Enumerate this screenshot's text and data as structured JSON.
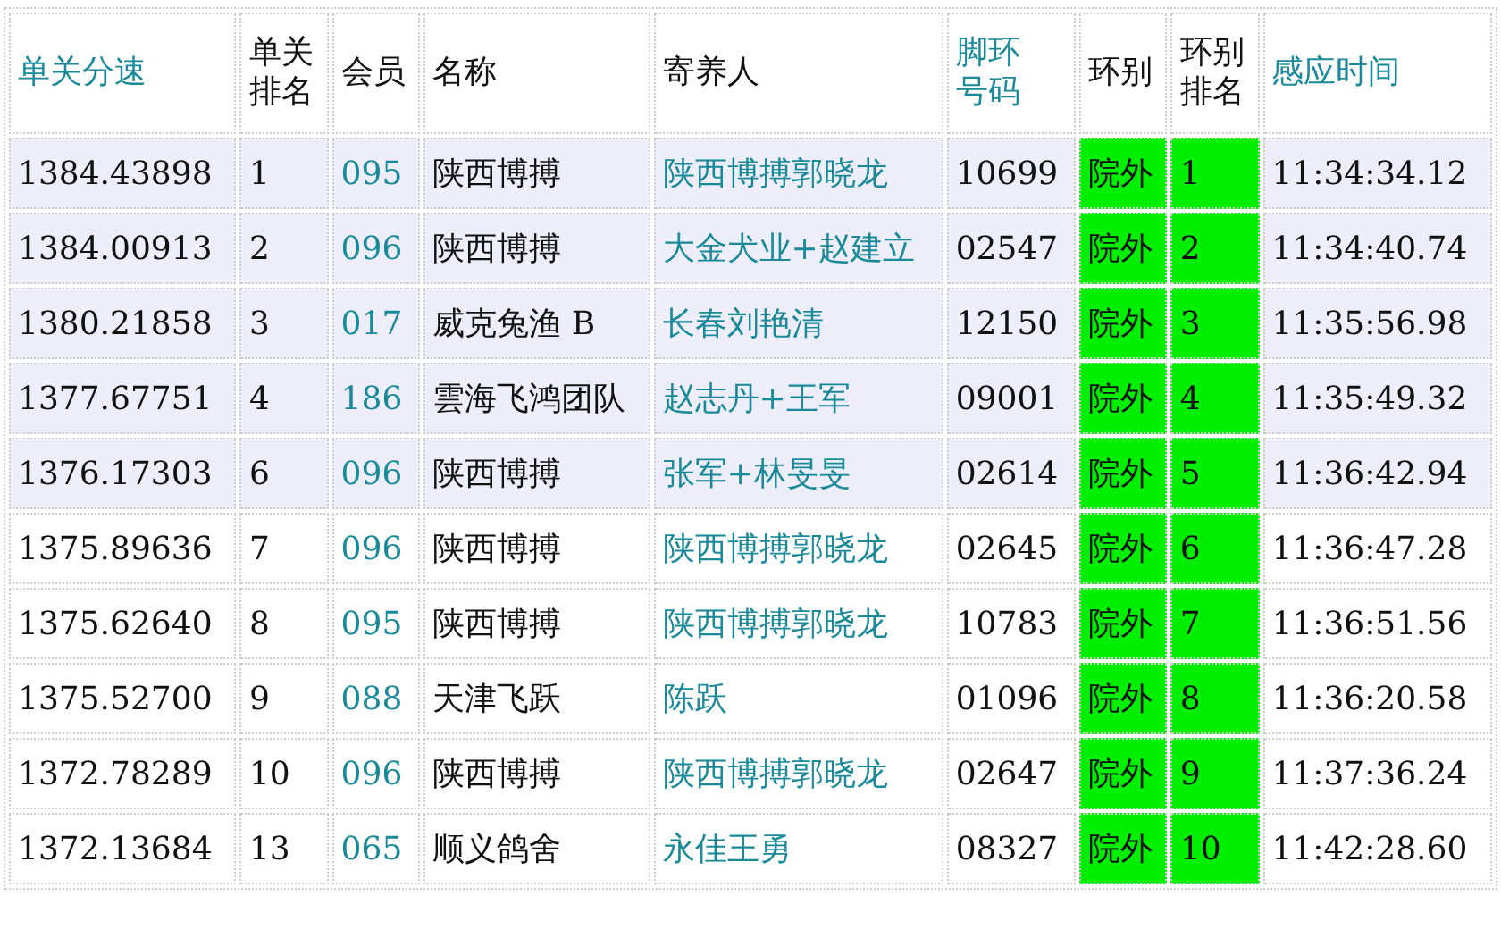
{
  "columns": [
    {
      "label": "单关分速",
      "sortable": true,
      "link": false,
      "green": false
    },
    {
      "label": "单关排名",
      "sortable": false,
      "link": false,
      "green": false
    },
    {
      "label": "会员",
      "sortable": false,
      "link": true,
      "green": false
    },
    {
      "label": "名称",
      "sortable": false,
      "link": false,
      "green": false
    },
    {
      "label": "寄养人",
      "sortable": false,
      "link": true,
      "green": false
    },
    {
      "label": "脚环号码",
      "sortable": true,
      "link": false,
      "green": false
    },
    {
      "label": "环别",
      "sortable": false,
      "link": false,
      "green": true
    },
    {
      "label": "环别排名",
      "sortable": false,
      "link": false,
      "green": true
    },
    {
      "label": "感应时间",
      "sortable": true,
      "link": false,
      "green": false
    }
  ],
  "rows": [
    {
      "highlighted": true,
      "cells": [
        "1384.43898",
        "1",
        "095",
        "陕西博搏",
        "陕西博搏郭晓龙",
        "10699",
        "院外",
        "1",
        "11:34:34.12"
      ]
    },
    {
      "highlighted": true,
      "cells": [
        "1384.00913",
        "2",
        "096",
        "陕西博搏",
        "大金犬业+赵建立",
        "02547",
        "院外",
        "2",
        "11:34:40.74"
      ]
    },
    {
      "highlighted": true,
      "cells": [
        "1380.21858",
        "3",
        "017",
        "威克兔渔 B",
        "长春刘艳清",
        "12150",
        "院外",
        "3",
        "11:35:56.98"
      ]
    },
    {
      "highlighted": true,
      "cells": [
        "1377.67751",
        "4",
        "186",
        "雲海飞鸿团队",
        "赵志丹+王军",
        "09001",
        "院外",
        "4",
        "11:35:49.32"
      ]
    },
    {
      "highlighted": true,
      "cells": [
        "1376.17303",
        "6",
        "096",
        "陕西博搏",
        "张军+林旻旻",
        "02614",
        "院外",
        "5",
        "11:36:42.94"
      ]
    },
    {
      "highlighted": false,
      "cells": [
        "1375.89636",
        "7",
        "096",
        "陕西博搏",
        "陕西博搏郭晓龙",
        "02645",
        "院外",
        "6",
        "11:36:47.28"
      ]
    },
    {
      "highlighted": false,
      "cells": [
        "1375.62640",
        "8",
        "095",
        "陕西博搏",
        "陕西博搏郭晓龙",
        "10783",
        "院外",
        "7",
        "11:36:51.56"
      ]
    },
    {
      "highlighted": false,
      "cells": [
        "1375.52700",
        "9",
        "088",
        "天津飞跃",
        "陈跃",
        "01096",
        "院外",
        "8",
        "11:36:20.58"
      ]
    },
    {
      "highlighted": false,
      "cells": [
        "1372.78289",
        "10",
        "096",
        "陕西博搏",
        "陕西博搏郭晓龙",
        "02647",
        "院外",
        "9",
        "11:37:36.24"
      ]
    },
    {
      "highlighted": false,
      "cells": [
        "1372.13684",
        "13",
        "065",
        "顺义鸽舍",
        "永佳王勇",
        "08327",
        "院外",
        "10",
        "11:42:28.60"
      ]
    }
  ]
}
